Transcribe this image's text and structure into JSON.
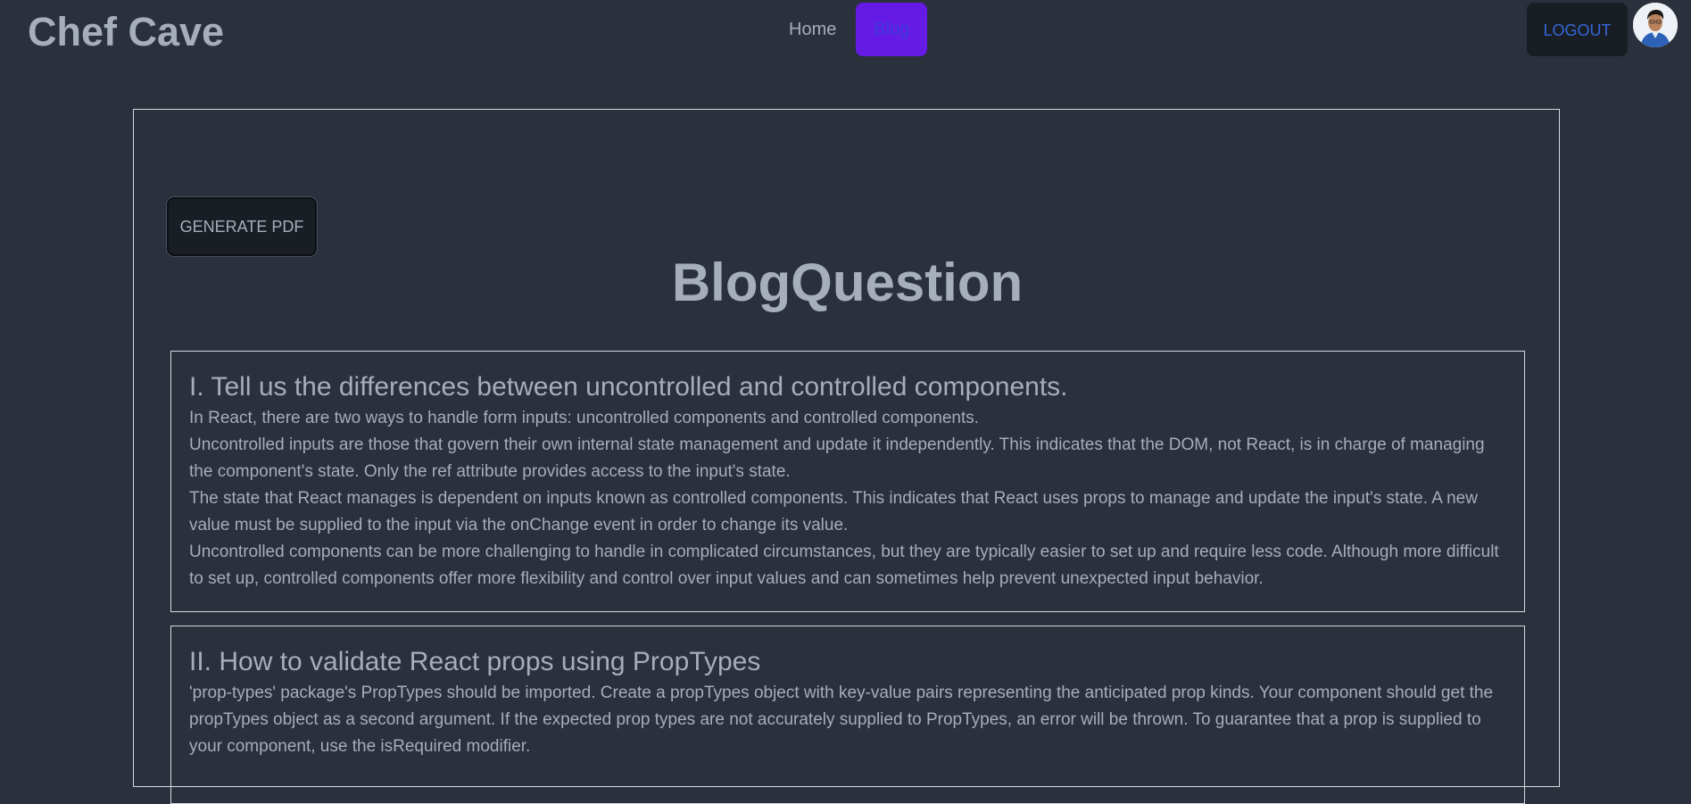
{
  "navbar": {
    "brand": "Chef Cave",
    "links": [
      {
        "label": "Home"
      },
      {
        "label": "Blog"
      }
    ],
    "logout_label": "LOGOUT"
  },
  "page": {
    "generate_pdf_label": "GENERATE PDF",
    "title": "BlogQuestion"
  },
  "questions": [
    {
      "title": "I. Tell us the differences between uncontrolled and controlled components.",
      "paragraphs": [
        "In React, there are two ways to handle form inputs: uncontrolled components and controlled components.",
        "Uncontrolled inputs are those that govern their own internal state management and update it independently. This indicates that the DOM, not React, is in charge of managing the component's state. Only the ref attribute provides access to the input's state.",
        "The state that React manages is dependent on inputs known as controlled components. This indicates that React uses props to manage and update the input's state. A new value must be supplied to the input via the onChange event in order to change its value.",
        "Uncontrolled components can be more challenging to handle in complicated circumstances, but they are typically easier to set up and require less code. Although more difficult to set up, controlled components offer more flexibility and control over input values and can sometimes help prevent unexpected input behavior."
      ]
    },
    {
      "title": "II. How to validate React props using PropTypes",
      "paragraphs": [
        "'prop-types' package's PropTypes should be imported. Create a propTypes object with key-value pairs representing the anticipated prop kinds. Your component should get the propTypes object as a second argument. If the expected prop types are not accurately supplied to PropTypes, an error will be thrown. To guarantee that a prop is supplied to your component, use the isRequired modifier."
      ]
    }
  ]
}
